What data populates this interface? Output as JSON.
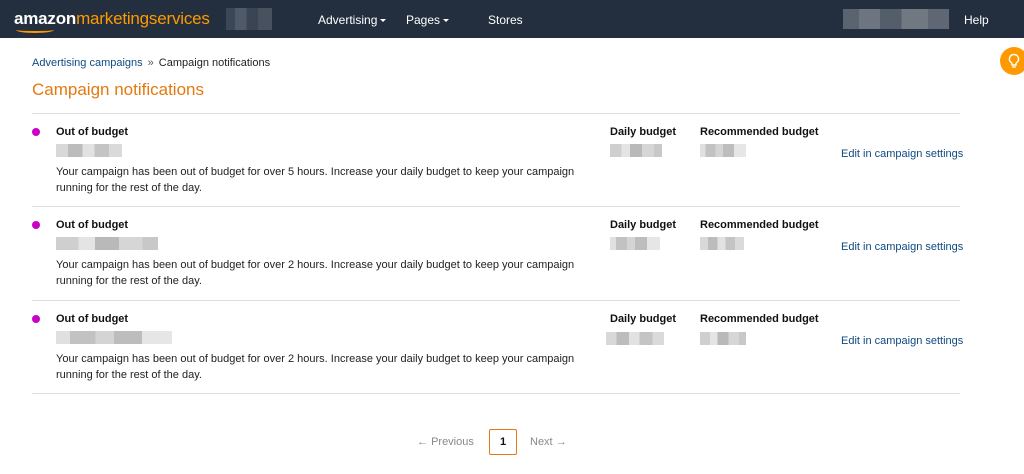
{
  "header": {
    "logo_primary": "amazon",
    "logo_secondary": "marketingservices",
    "nav": [
      {
        "label": "Advertising",
        "has_dropdown": true
      },
      {
        "label": "Pages",
        "has_dropdown": true
      },
      {
        "label": "Stores",
        "has_dropdown": false
      }
    ],
    "help_label": "Help"
  },
  "breadcrumb": {
    "link": "Advertising campaigns",
    "separator": "»",
    "current": "Campaign notifications"
  },
  "page_title": "Campaign notifications",
  "notifications": [
    {
      "title": "Out of budget",
      "message": "Your campaign has been out of budget for over 5 hours. Increase your daily budget to keep your campaign running for the rest of the day.",
      "daily_budget_label": "Daily budget",
      "recommended_budget_label": "Recommended budget",
      "edit_link": "Edit in campaign settings"
    },
    {
      "title": "Out of budget",
      "message": "Your campaign has been out of budget for over 2 hours. Increase your daily budget to keep your campaign running for the rest of the day.",
      "daily_budget_label": "Daily budget",
      "recommended_budget_label": "Recommended budget",
      "edit_link": "Edit in campaign settings"
    },
    {
      "title": "Out of budget",
      "message": "Your campaign has been out of budget for over 2 hours. Increase your daily budget to keep your campaign running for the rest of the day.",
      "daily_budget_label": "Daily budget",
      "recommended_budget_label": "Recommended budget",
      "edit_link": "Edit in campaign settings"
    }
  ],
  "pagination": {
    "previous_label": "Previous",
    "current_page": "1",
    "next_label": "Next"
  },
  "colors": {
    "header_bg": "#232f3e",
    "accent_orange": "#e47911",
    "brand_orange": "#ff9900",
    "link_blue": "#0e4a80",
    "status_dot": "#c902c9"
  }
}
